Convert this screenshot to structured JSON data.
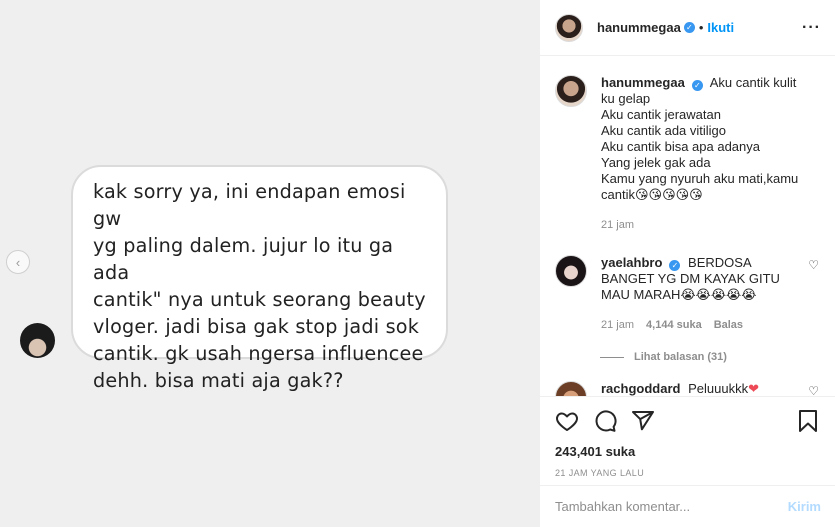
{
  "dm": {
    "message": "kak sorry ya, ini endapan emosi gw\nyg paling dalem. jujur lo itu ga ada\ncantik\" nya untuk seorang beauty\nvloger. jadi bisa gak stop jadi sok\ncantik. gk usah ngersa influencee\ndehh. bisa mati aja gak??"
  },
  "header": {
    "username": "hanummegaa",
    "separator": "•",
    "follow_label": "Ikuti",
    "more_label": "···"
  },
  "caption": {
    "username": "hanummegaa",
    "lines": [
      "Aku cantik kulit ku gelap",
      "Aku cantik jerawatan",
      "Aku cantik ada vitiligo",
      "Aku cantik bisa apa adanya",
      "Yang jelek gak ada",
      "Kamu yang nyuruh aku mati,kamu cantik😘😘😘😘😘"
    ],
    "time": "21 jam"
  },
  "comments": [
    {
      "username": "yaelahbro",
      "text": "BERDOSA BANGET YG DM KAYAK GITU MAU MARAH😭😭😭😭😭",
      "time": "21 jam",
      "likes": "4,144 suka",
      "reply_label": "Balas",
      "view_replies": "Lihat balasan (31)"
    },
    {
      "username": "rachgoddard",
      "text": "Peluuukkk",
      "emoji": "❤"
    }
  ],
  "post": {
    "likes": "243,401 suka",
    "time": "21 JAM YANG LALU"
  },
  "add_comment": {
    "placeholder": "Tambahkan komentar...",
    "post_label": "Kirim"
  },
  "icons": {
    "like": "heart-icon",
    "comment": "comment-icon",
    "share": "share-icon",
    "save": "bookmark-icon",
    "prev": "chevron-left-icon",
    "verified": "verified-badge-icon"
  },
  "colors": {
    "link_blue": "#0095f6",
    "verified_blue": "#3897f0",
    "secondary_text": "#8e8e8e"
  }
}
